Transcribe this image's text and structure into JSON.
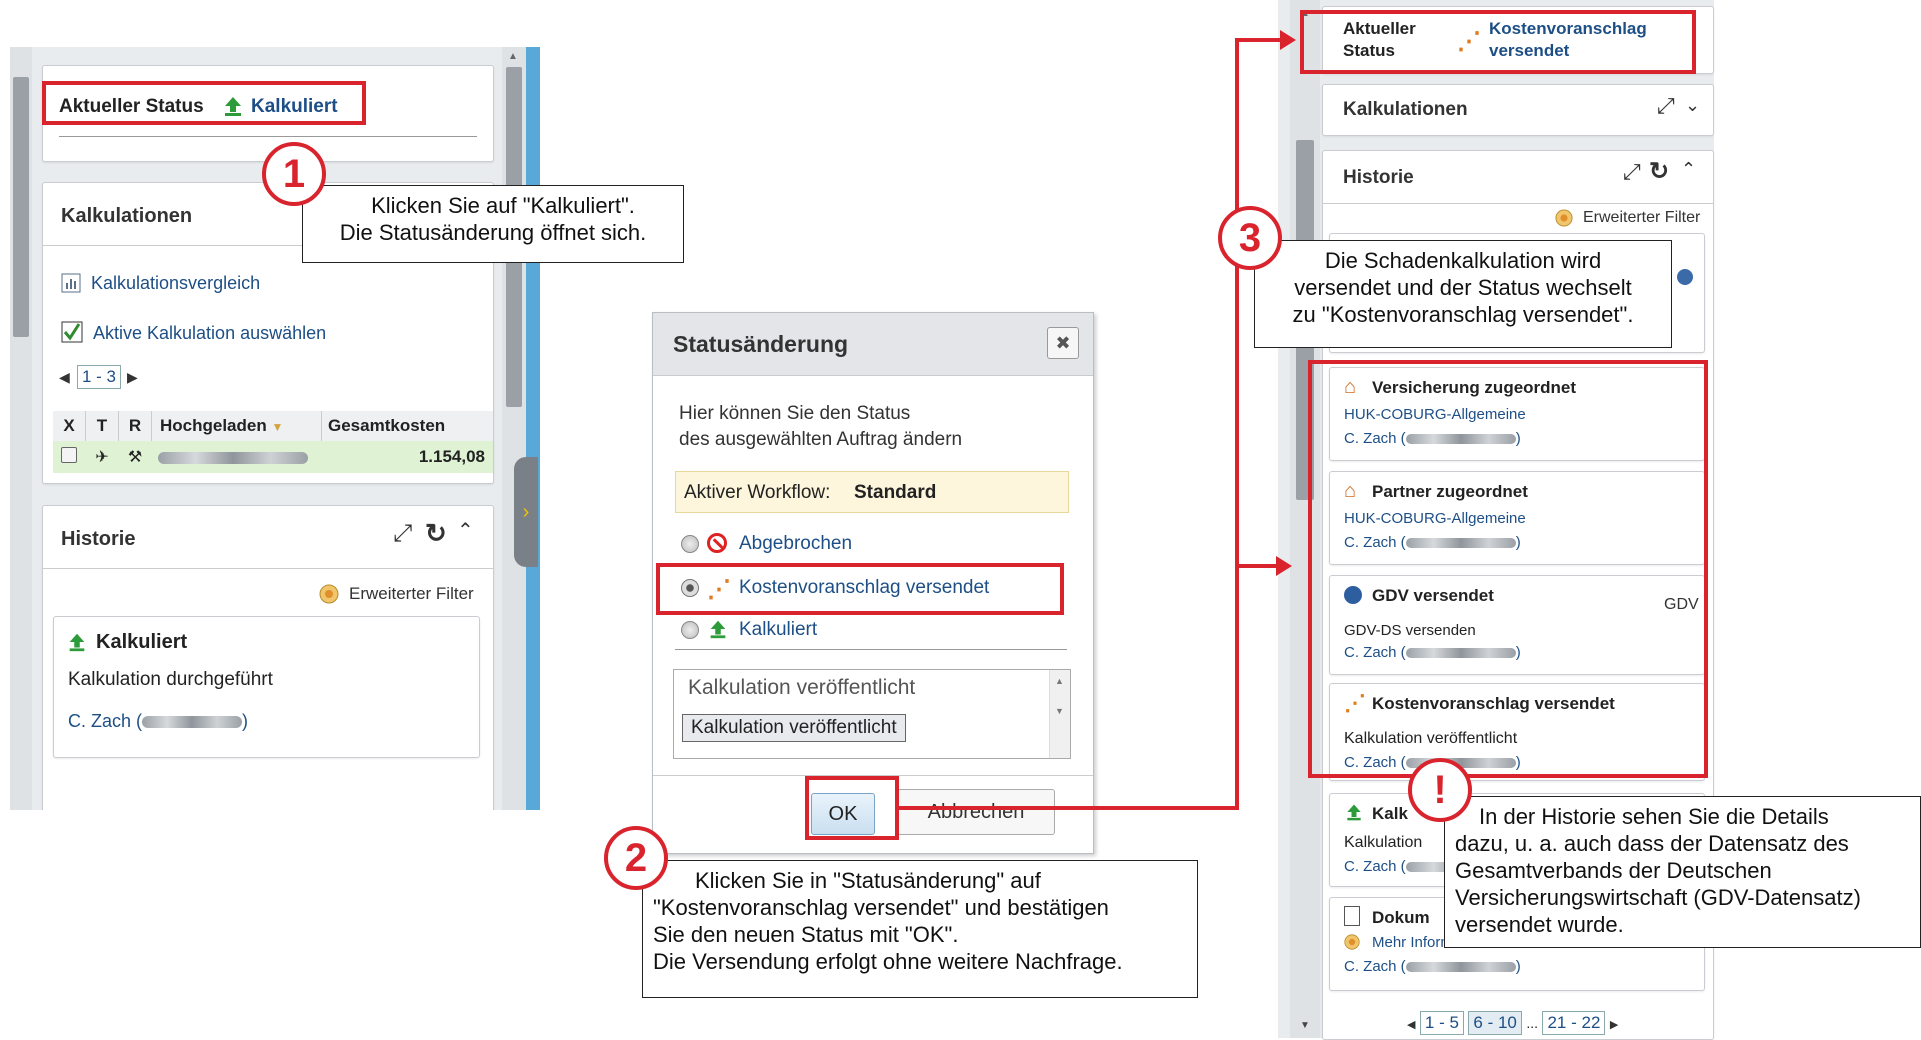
{
  "panel1": {
    "status_label": "Aktueller Status",
    "status_value": "Kalkuliert",
    "kalkulationen_title": "Kalkulationen",
    "kalkulationsvergleich": "Kalkulationsvergleich",
    "aktive_kalkulation": "Aktive Kalkulation auswählen",
    "pager": "1 - 3",
    "table": {
      "headers": [
        "X",
        "T",
        "R",
        "Hochgeladen",
        "Gesamtkosten"
      ],
      "row_value": "1.154,08"
    },
    "historie_title": "Historie",
    "filter_label": "Erweiterter Filter",
    "entry_title": "Kalkuliert",
    "entry_text": "Kalkulation durchgeführt",
    "entry_user": "C. Zach ("
  },
  "dialog": {
    "title": "Statusänderung",
    "close": "✖",
    "description_line1": "Hier können Sie den Status",
    "description_line2": "des ausgewählten Auftrag ändern",
    "workflow_label": "Aktiver Workflow:",
    "workflow_value": "Standard",
    "options": [
      {
        "label": "Abgebrochen",
        "selected": false
      },
      {
        "label": "Kostenvoranschlag versendet",
        "selected": true
      },
      {
        "label": "Kalkuliert",
        "selected": false
      }
    ],
    "textarea_header": "Kalkulation veröffentlicht",
    "textarea_chip": "Kalkulation veröffentlicht",
    "ok": "OK",
    "cancel": "Abbrechen"
  },
  "panel3": {
    "status_label_line1": "Aktueller",
    "status_label_line2": "Status",
    "status_value_line1": "Kostenvoranschlag",
    "status_value_line2": "versendet",
    "kalkulationen_title": "Kalkulationen",
    "historie_title": "Historie",
    "filter_label": "Erweiterter Filter",
    "entries": [
      {
        "title": "Versicherung zugeordnet",
        "line": "HUK-COBURG-Allgemeine",
        "user": "C. Zach (",
        "tag": ""
      },
      {
        "title": "Partner zugeordnet",
        "line": "HUK-COBURG-Allgemeine",
        "user": "C. Zach (",
        "tag": ""
      },
      {
        "title": "GDV versendet",
        "line": "GDV-DS versenden",
        "user": "C. Zach (",
        "tag": "GDV"
      },
      {
        "title": "Kostenvoranschlag versendet",
        "line": "Kalkulation veröffentlicht",
        "user": "C. Zach (",
        "tag": ""
      }
    ],
    "lower_entries": [
      {
        "title": "Kalk",
        "line": "Kalkulation",
        "user": "C. Zach ("
      },
      {
        "title": "Dokum",
        "line": "Mehr Informationen",
        "user": "C. Zach ("
      }
    ],
    "pager": [
      "1 - 5",
      "6 - 10",
      "...",
      "21 - 22"
    ]
  },
  "callouts": {
    "badge1": "1",
    "c1_line1": "Klicken Sie auf \"Kalkuliert\".",
    "c1_line2": "Die Statusänderung öffnet sich.",
    "badge2": "2",
    "c2_line1": "Klicken Sie in \"Statusänderung\" auf",
    "c2_line2": "\"Kostenvoranschlag versendet\" und bestätigen",
    "c2_line3": "Sie den neuen Status mit \"OK\".",
    "c2_line4": "Die Versendung erfolgt ohne weitere Nachfrage.",
    "badge3": "3",
    "c3_line1": "Die Schadenkalkulation wird",
    "c3_line2": "versendet und der Status wechselt",
    "c3_line3": "zu \"Kostenvoranschlag versendet\".",
    "badge4": "!",
    "c4_line1": "In der Historie sehen Sie die Details",
    "c4_line2": "dazu, u. a. auch dass der Datensatz des",
    "c4_line3": "Gesamtverbands der Deutschen",
    "c4_line4": "Versicherungswirtschaft (GDV-Datensatz)",
    "c4_line5": "versendet wurde."
  },
  "colors": {
    "highlight": "#d9232d",
    "link": "#1d4f86",
    "workflow_bg": "#fdf6dc"
  }
}
